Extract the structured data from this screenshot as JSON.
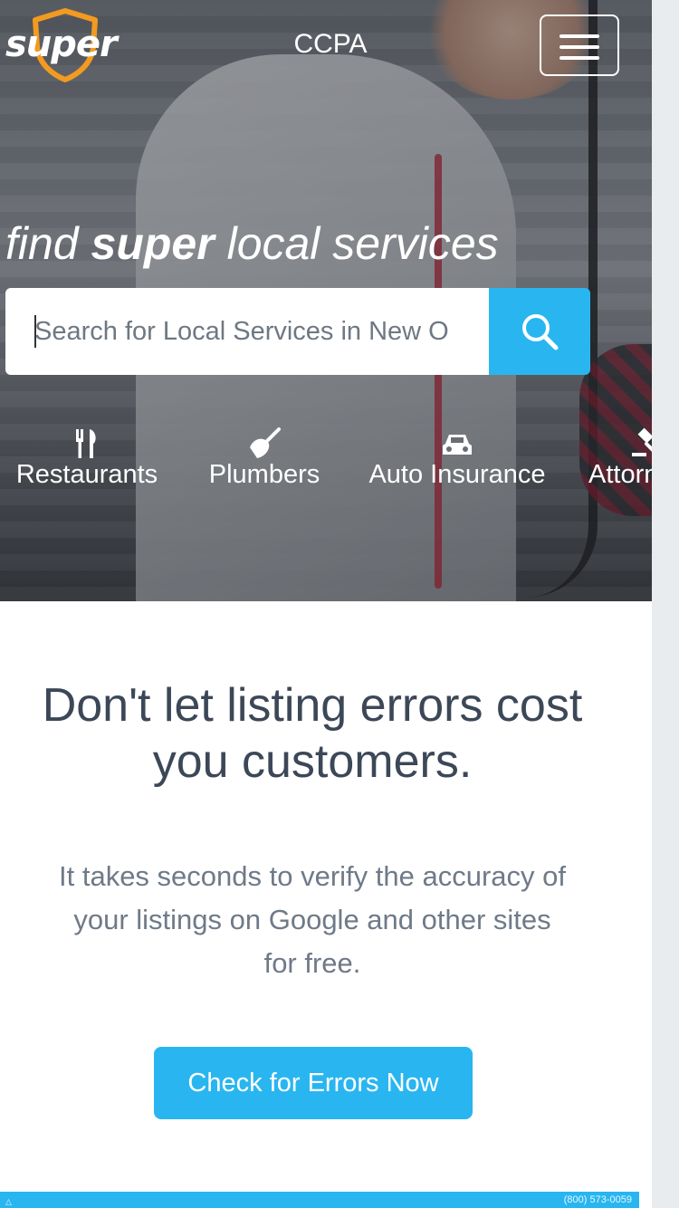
{
  "header": {
    "logo_text": "super",
    "title": "CCPA",
    "menu_label": "Menu"
  },
  "hero": {
    "tagline": {
      "part1": "find ",
      "bold": "super",
      "part2": " local services"
    },
    "search": {
      "placeholder": "Search for Local Services in New O"
    },
    "categories": [
      {
        "label": "Restaurants",
        "icon": "fork-knife-icon"
      },
      {
        "label": "Plumbers",
        "icon": "plunger-icon"
      },
      {
        "label": "Auto Insurance",
        "icon": "car-icon"
      },
      {
        "label": "Attorneys",
        "icon": "gavel-icon"
      }
    ]
  },
  "content": {
    "headline": "Don't let listing errors cost you customers.",
    "subtext": "It takes seconds to verify the accuracy of your listings on Google and other sites for free.",
    "cta_label": "Check for Errors Now"
  },
  "banner": {
    "phone": "(800) 573-0059"
  },
  "colors": {
    "accent": "#29b6f0",
    "logo_orange": "#f39a21",
    "headline": "#3c4757",
    "body_text": "#6f7a88"
  }
}
